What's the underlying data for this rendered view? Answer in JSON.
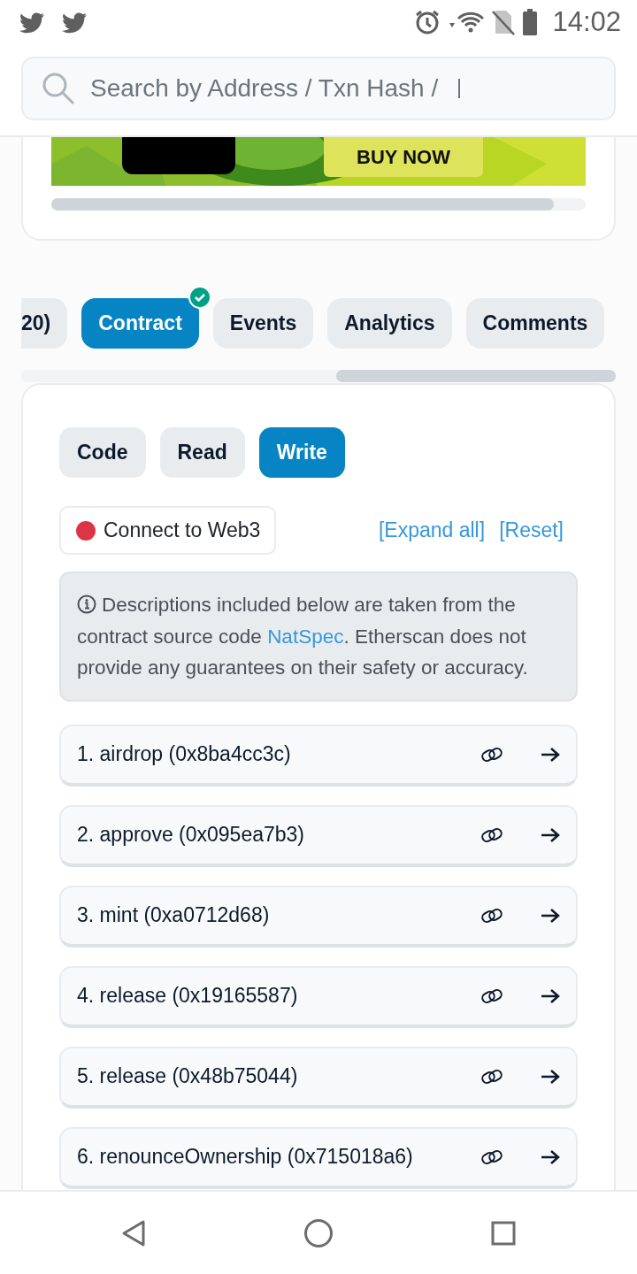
{
  "status_bar": {
    "time": "14:02"
  },
  "search": {
    "placeholder": "Search by Address / Txn Hash / "
  },
  "ad": {
    "button": "BUY NOW"
  },
  "tabs": [
    {
      "label": "20)",
      "selected": false,
      "verified": false
    },
    {
      "label": "Contract",
      "selected": true,
      "verified": true
    },
    {
      "label": "Events",
      "selected": false,
      "verified": false
    },
    {
      "label": "Analytics",
      "selected": false,
      "verified": false
    },
    {
      "label": "Comments",
      "selected": false,
      "verified": false
    }
  ],
  "subtabs": [
    {
      "label": "Code",
      "selected": false
    },
    {
      "label": "Read",
      "selected": false
    },
    {
      "label": "Write",
      "selected": true
    }
  ],
  "connect": {
    "label": "Connect to Web3",
    "connected": false
  },
  "links": [
    "[Expand all]",
    "[Reset]"
  ],
  "notice": {
    "text": "Descriptions included below are taken from the contract source code ",
    "link": "NatSpec",
    "text_after": ". Etherscan does not provide any guarantees on their safety or accuracy."
  },
  "functions": [
    {
      "label": "1. airdrop (0x8ba4cc3c)"
    },
    {
      "label": "2. approve (0x095ea7b3)"
    },
    {
      "label": "3. mint (0xa0712d68)"
    },
    {
      "label": "4. release (0x19165587)"
    },
    {
      "label": "5. release (0x48b75044)"
    },
    {
      "label": "6. renounceOwnership (0x715018a6)"
    }
  ]
}
